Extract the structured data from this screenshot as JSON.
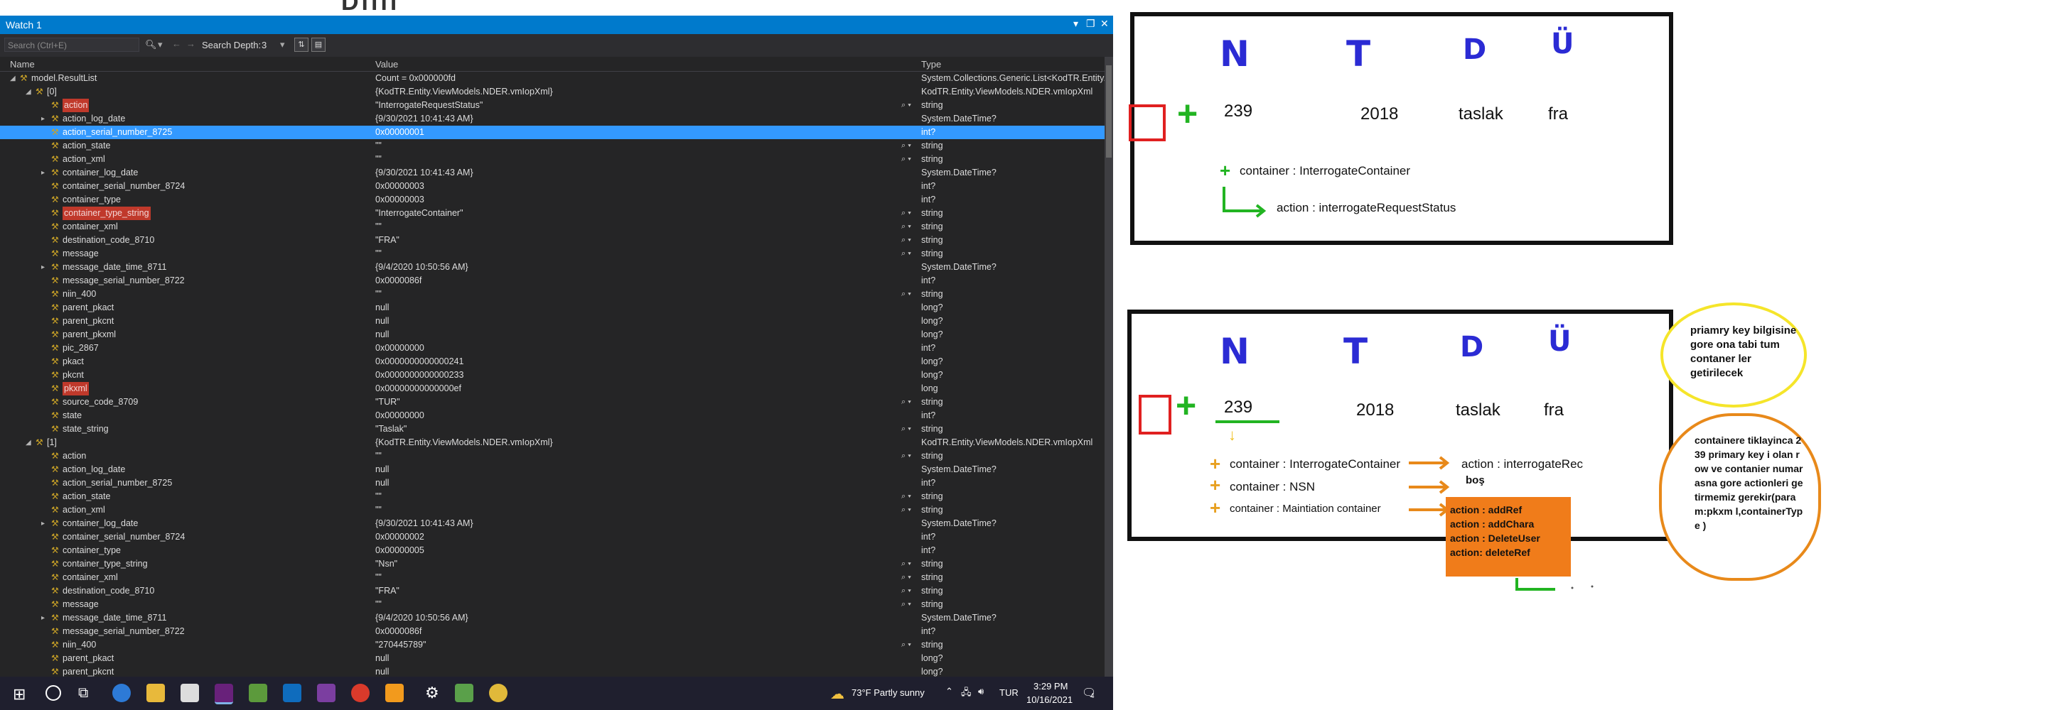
{
  "watch": {
    "title": "Watch 1",
    "search_placeholder": "Search (Ctrl+E)",
    "search_depth_label": "Search Depth:",
    "search_depth_value": "3",
    "columns": {
      "name": "Name",
      "value": "Value",
      "type": "Type"
    },
    "rows": [
      {
        "name": "model.ResultList",
        "value": "Count = 0x000000fd",
        "type": "System.Collections.Generic.List<KodTR.Entity....",
        "indent": 1,
        "exp": "◢"
      },
      {
        "name": "[0]",
        "value": "{KodTR.Entity.ViewModels.NDER.vmIopXml}",
        "type": "KodTR.Entity.ViewModels.NDER.vmIopXml",
        "indent": 2,
        "exp": "◢"
      },
      {
        "name": "action",
        "value": "\"InterrogateRequestStatus\"",
        "type": "string",
        "indent": 3,
        "hl": true,
        "mag": true
      },
      {
        "name": "action_log_date",
        "value": "{9/30/2021 10:41:43 AM}",
        "type": "System.DateTime?",
        "indent": 3,
        "exp": "▸"
      },
      {
        "name": "action_serial_number_8725",
        "value": "0x00000001",
        "type": "int?",
        "indent": 3,
        "sel": true
      },
      {
        "name": "action_state",
        "value": "\"\"",
        "type": "string",
        "indent": 3,
        "mag": true
      },
      {
        "name": "action_xml",
        "value": "\"\"",
        "type": "string",
        "indent": 3,
        "mag": true
      },
      {
        "name": "container_log_date",
        "value": "{9/30/2021 10:41:43 AM}",
        "type": "System.DateTime?",
        "indent": 3,
        "exp": "▸"
      },
      {
        "name": "container_serial_number_8724",
        "value": "0x00000003",
        "type": "int?",
        "indent": 3
      },
      {
        "name": "container_type",
        "value": "0x00000003",
        "type": "int?",
        "indent": 3
      },
      {
        "name": "container_type_string",
        "value": "\"InterrogateContainer\"",
        "type": "string",
        "indent": 3,
        "hl": true,
        "mag": true
      },
      {
        "name": "container_xml",
        "value": "\"\"",
        "type": "string",
        "indent": 3,
        "mag": true
      },
      {
        "name": "destination_code_8710",
        "value": "\"FRA\"",
        "type": "string",
        "indent": 3,
        "mag": true
      },
      {
        "name": "message",
        "value": "\"\"",
        "type": "string",
        "indent": 3,
        "mag": true
      },
      {
        "name": "message_date_time_8711",
        "value": "{9/4/2020 10:50:56 AM}",
        "type": "System.DateTime?",
        "indent": 3,
        "exp": "▸"
      },
      {
        "name": "message_serial_number_8722",
        "value": "0x0000086f",
        "type": "int?",
        "indent": 3
      },
      {
        "name": "niin_400",
        "value": "\"\"",
        "type": "string",
        "indent": 3,
        "mag": true
      },
      {
        "name": "parent_pkact",
        "value": "null",
        "type": "long?",
        "indent": 3
      },
      {
        "name": "parent_pkcnt",
        "value": "null",
        "type": "long?",
        "indent": 3
      },
      {
        "name": "parent_pkxml",
        "value": "null",
        "type": "long?",
        "indent": 3
      },
      {
        "name": "pic_2867",
        "value": "0x00000000",
        "type": "int?",
        "indent": 3
      },
      {
        "name": "pkact",
        "value": "0x0000000000000241",
        "type": "long?",
        "indent": 3
      },
      {
        "name": "pkcnt",
        "value": "0x0000000000000233",
        "type": "long?",
        "indent": 3
      },
      {
        "name": "pkxml",
        "value": "0x00000000000000ef",
        "type": "long",
        "indent": 3,
        "hl": true
      },
      {
        "name": "source_code_8709",
        "value": "\"TUR\"",
        "type": "string",
        "indent": 3,
        "mag": true
      },
      {
        "name": "state",
        "value": "0x00000000",
        "type": "int?",
        "indent": 3
      },
      {
        "name": "state_string",
        "value": "\"Taslak\"",
        "type": "string",
        "indent": 3,
        "mag": true
      },
      {
        "name": "[1]",
        "value": "{KodTR.Entity.ViewModels.NDER.vmIopXml}",
        "type": "KodTR.Entity.ViewModels.NDER.vmIopXml",
        "indent": 2,
        "exp": "◢"
      },
      {
        "name": "action",
        "value": "\"\"",
        "type": "string",
        "indent": 3,
        "mag": true
      },
      {
        "name": "action_log_date",
        "value": "null",
        "type": "System.DateTime?",
        "indent": 3
      },
      {
        "name": "action_serial_number_8725",
        "value": "null",
        "type": "int?",
        "indent": 3
      },
      {
        "name": "action_state",
        "value": "\"\"",
        "type": "string",
        "indent": 3,
        "mag": true
      },
      {
        "name": "action_xml",
        "value": "\"\"",
        "type": "string",
        "indent": 3,
        "mag": true
      },
      {
        "name": "container_log_date",
        "value": "{9/30/2021 10:41:43 AM}",
        "type": "System.DateTime?",
        "indent": 3,
        "exp": "▸"
      },
      {
        "name": "container_serial_number_8724",
        "value": "0x00000002",
        "type": "int?",
        "indent": 3
      },
      {
        "name": "container_type",
        "value": "0x00000005",
        "type": "int?",
        "indent": 3
      },
      {
        "name": "container_type_string",
        "value": "\"Nsn\"",
        "type": "string",
        "indent": 3,
        "mag": true
      },
      {
        "name": "container_xml",
        "value": "\"\"",
        "type": "string",
        "indent": 3,
        "mag": true
      },
      {
        "name": "destination_code_8710",
        "value": "\"FRA\"",
        "type": "string",
        "indent": 3,
        "mag": true
      },
      {
        "name": "message",
        "value": "\"\"",
        "type": "string",
        "indent": 3,
        "mag": true
      },
      {
        "name": "message_date_time_8711",
        "value": "{9/4/2020 10:50:56 AM}",
        "type": "System.DateTime?",
        "indent": 3,
        "exp": "▸"
      },
      {
        "name": "message_serial_number_8722",
        "value": "0x0000086f",
        "type": "int?",
        "indent": 3
      },
      {
        "name": "niin_400",
        "value": "\"270445789\"",
        "type": "string",
        "indent": 3,
        "mag": true
      },
      {
        "name": "parent_pkact",
        "value": "null",
        "type": "long?",
        "indent": 3
      },
      {
        "name": "parent_pkcnt",
        "value": "null",
        "type": "long?",
        "indent": 3
      }
    ]
  },
  "taskbar": {
    "weather": "73°F  Partly sunny",
    "lang": "TUR",
    "time": "3:29 PM",
    "date": "10/16/2021",
    "notif_count": "4"
  },
  "board1": {
    "headers": [
      "N",
      "T",
      "D",
      "Ü"
    ],
    "values": [
      "239",
      "2018",
      "taslak",
      "fra"
    ],
    "container": "container : InterrogateContainer",
    "action": "action : interrogateRequestStatus"
  },
  "board2": {
    "headers": [
      "N",
      "T",
      "D",
      "Ü"
    ],
    "values": [
      "239",
      "2018",
      "taslak",
      "fra"
    ],
    "containers": [
      "container : InterrogateContainer",
      "container :  NSN",
      "container : Maintiation container"
    ],
    "action_interrogate": "action : interrogateRec",
    "bos": "boş",
    "orange_actions": [
      "action :  addRef",
      "action :  addChara",
      "action : DeleteUser",
      "action:  deleteRef"
    ]
  },
  "notes": {
    "yellow": "priamry key bilgisine gore ona tabi tum contaner ler getirilecek",
    "orange": "containere tiklayinca 239 primary key i olan row ve contanier numarasna gore actionleri getirmemiz gerekir(param:pkxm l,containerType )"
  }
}
